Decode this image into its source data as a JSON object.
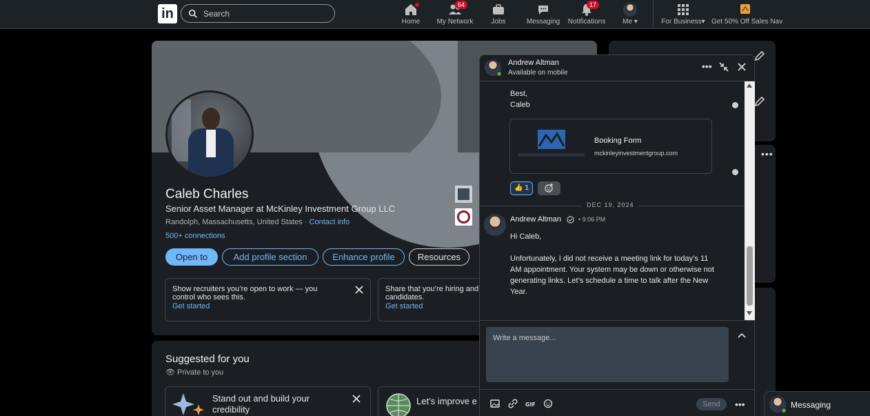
{
  "nav": {
    "search_placeholder": "Search",
    "items": [
      {
        "label": "Home",
        "badge": ""
      },
      {
        "label": "My Network",
        "badge": "64"
      },
      {
        "label": "Jobs",
        "badge": ""
      },
      {
        "label": "Messaging",
        "badge": ""
      },
      {
        "label": "Notifications",
        "badge": "17"
      },
      {
        "label": "Me",
        "badge": ""
      },
      {
        "label": "For Business",
        "badge": ""
      },
      {
        "label": "Get 50% Off Sales Nav",
        "badge": ""
      }
    ]
  },
  "profile": {
    "name": "Caleb Charles",
    "headline": "Senior Asset Manager at McKinley Investment Group LLC",
    "location": "Randolph, Massachusetts, United States",
    "location_sep": " · ",
    "contact_info": "Contact info",
    "connections": "500+ connections",
    "buttons": {
      "open_to": "Open to",
      "add_section": "Add profile section",
      "enhance": "Enhance profile",
      "resources": "Resources"
    },
    "promo_open_to_work": {
      "text": "Show recruiters you’re open to work — you control who sees this.",
      "link": "Get started"
    },
    "promo_hiring": {
      "text": "Share that you’re hiring and attract qualified candidates.",
      "link": "Get started"
    }
  },
  "suggested": {
    "title": "Suggested for you",
    "privacy": "Private to you",
    "card1": "Stand out and build your credibility",
    "card2": "Let’s improve e opportunity"
  },
  "messaging": {
    "contact_name": "Andrew Altman",
    "contact_status": "Available on mobile",
    "prev_lines": [
      "Best,",
      "Caleb"
    ],
    "link_card": {
      "title": "Booking Form",
      "domain": "mckinleyinvestmentgroup.com"
    },
    "reaction": "👍 1",
    "date_divider": "DEC 19, 2024",
    "sender": "Andrew Altman",
    "time": "• 9:06 PM",
    "body": "Hi Caleb,\n\nUnfortunately, I did not receive a meeting link for today’s 11 AM appointment.  Your system may be down or otherwise not generating links.  Let’s schedule a time to talk after the New Year.",
    "compose_placeholder": "Write a message...",
    "send_label": "Send"
  },
  "dock": {
    "label": "Messaging"
  },
  "colors": {
    "accent": "#71b7fb",
    "card_bg": "#1b1f23",
    "nav_bg": "#1d2226",
    "badge": "#cb112d",
    "presence": "#5f9b41"
  }
}
